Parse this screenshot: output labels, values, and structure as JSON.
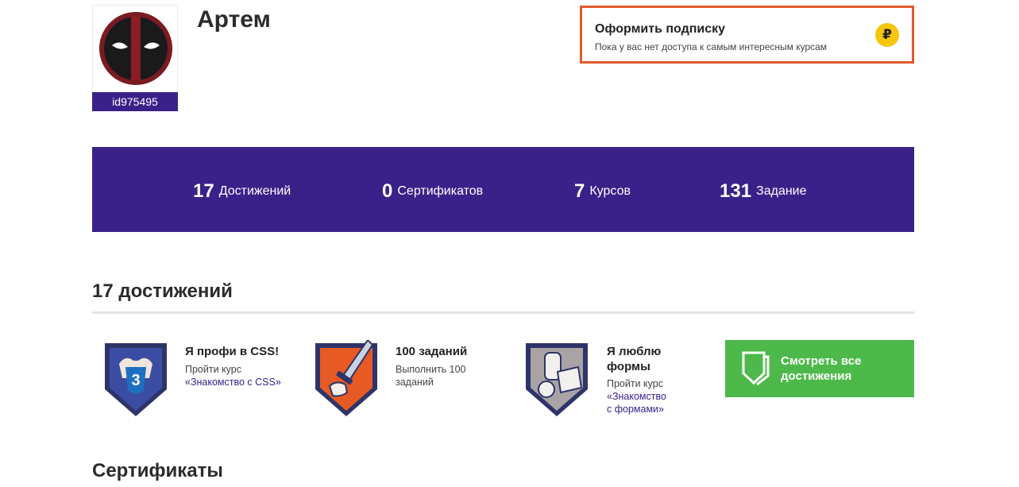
{
  "profile": {
    "name": "Артем",
    "user_id": "id975495"
  },
  "subscribe": {
    "title": "Оформить подписку",
    "subtitle": "Пока у вас нет доступа к самым интересным курсам",
    "currency_symbol": "₽"
  },
  "stats": [
    {
      "value": "17",
      "label": "Достижений"
    },
    {
      "value": "0",
      "label": "Сертификатов"
    },
    {
      "value": "7",
      "label": "Курсов"
    },
    {
      "value": "131",
      "label": "Задание"
    }
  ],
  "achievements_section": {
    "title": "17 достижений",
    "items": [
      {
        "title": "Я профи в CSS!",
        "desc_prefix": "Пройти курс",
        "link_text": "«Знакомство с CSS»",
        "icon": "css-badge-icon"
      },
      {
        "title": "100 заданий",
        "desc_prefix": "Выполнить 100 заданий",
        "link_text": "",
        "icon": "sword-badge-icon"
      },
      {
        "title": "Я люблю формы",
        "desc_prefix": "Пройти курс",
        "link_text": "«Знакомство с формами»",
        "icon": "shapes-badge-icon"
      }
    ],
    "see_all_label": "Смотреть все достижения"
  },
  "certificates_section": {
    "title": "Сертификаты"
  },
  "colors": {
    "brand_purple": "#3a2189",
    "accent_orange": "#e05a2b",
    "success_green": "#4db94a",
    "coin_yellow": "#f6c60b"
  }
}
